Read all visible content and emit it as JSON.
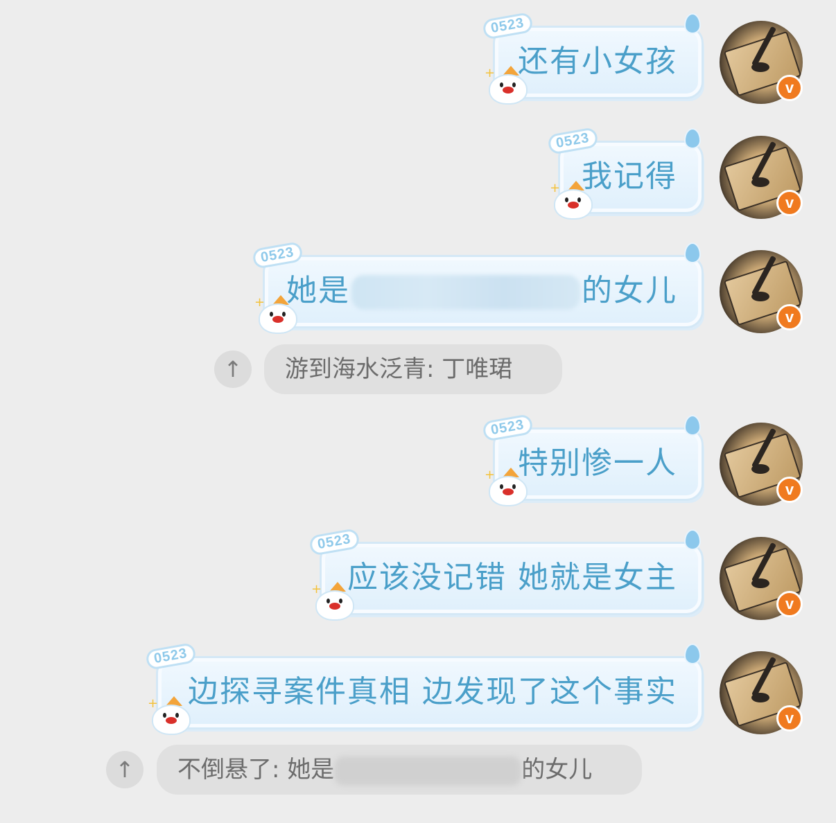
{
  "messages": [
    {
      "text": "还有小女孩",
      "tag": "0523"
    },
    {
      "text": "我记得",
      "tag": "0523"
    },
    {
      "text_before": "她是",
      "text_after": "的女儿",
      "tag": "0523"
    },
    {
      "text": "特别惨一人",
      "tag": "0523"
    },
    {
      "text": "应该没记错 她就是女主",
      "tag": "0523"
    },
    {
      "text": "边探寻案件真相 边发现了这个事实",
      "tag": "0523"
    }
  ],
  "quotes": [
    {
      "text": "游到海水泛青: 丁唯珺",
      "pin_icon": "pin-icon"
    },
    {
      "text_before": "不倒悬了: 她是",
      "text_after": "的女儿",
      "pin_icon": "pin-icon"
    }
  ],
  "avatar_badge": "v",
  "colors": {
    "bubble_text": "#4a9fc9",
    "badge": "#f07a1f",
    "background": "#ededed"
  }
}
